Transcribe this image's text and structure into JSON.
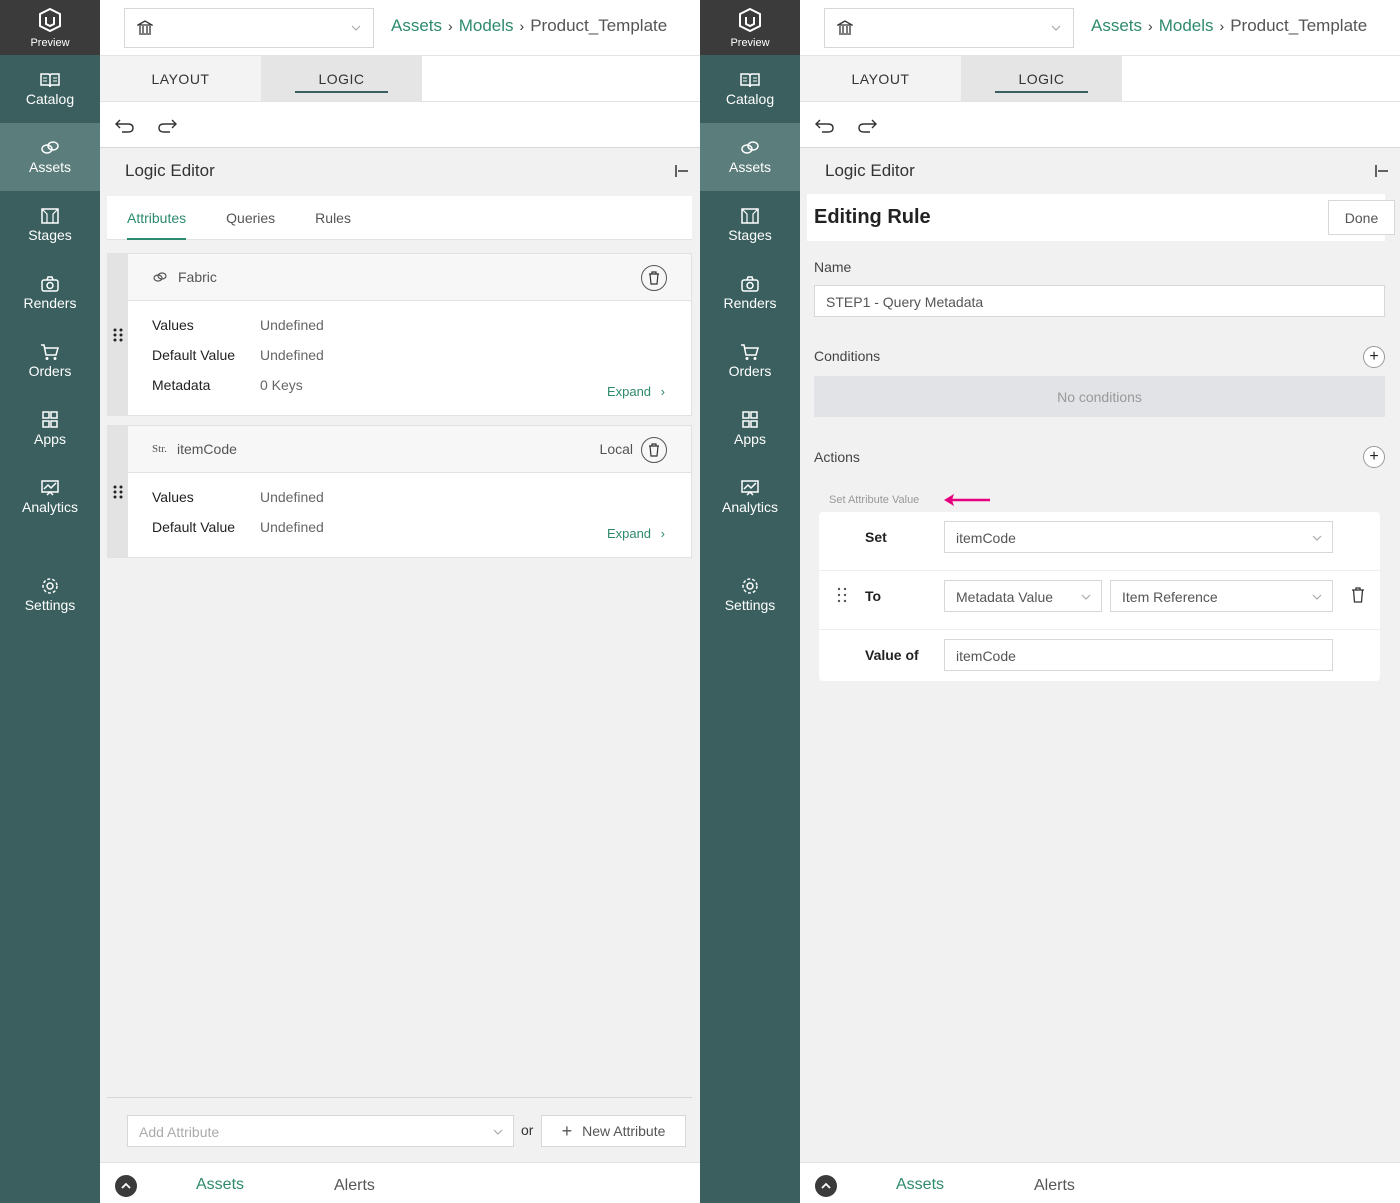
{
  "sidebar": {
    "preview_label": "Preview",
    "items": [
      {
        "label": "Catalog",
        "icon": "book-icon"
      },
      {
        "label": "Assets",
        "icon": "assets-icon"
      },
      {
        "label": "Stages",
        "icon": "stage-icon"
      },
      {
        "label": "Renders",
        "icon": "camera-icon"
      },
      {
        "label": "Orders",
        "icon": "cart-icon"
      },
      {
        "label": "Apps",
        "icon": "grid-icon"
      },
      {
        "label": "Analytics",
        "icon": "chart-icon"
      }
    ],
    "settings_label": "Settings"
  },
  "breadcrumb": {
    "assets": "Assets",
    "models": "Models",
    "current": "Product_Template"
  },
  "tabs": {
    "layout": "LAYOUT",
    "logic": "LOGIC"
  },
  "logic_editor": {
    "title": "Logic Editor"
  },
  "left": {
    "subtabs": [
      "Attributes",
      "Queries",
      "Rules"
    ],
    "attributes": [
      {
        "name": "Fabric",
        "type_icon": "assets-icon",
        "rows": [
          {
            "k": "Values",
            "v": "Undefined"
          },
          {
            "k": "Default Value",
            "v": "Undefined"
          },
          {
            "k": "Metadata",
            "v": "0 Keys"
          }
        ],
        "expand": "Expand"
      },
      {
        "name": "itemCode",
        "type_label": "Str.",
        "local": "Local",
        "rows": [
          {
            "k": "Values",
            "v": "Undefined"
          },
          {
            "k": "Default Value",
            "v": "Undefined"
          }
        ],
        "expand": "Expand"
      }
    ],
    "add_attribute_placeholder": "Add Attribute",
    "or": "or",
    "new_attribute": "New Attribute"
  },
  "right": {
    "rule_title": "Editing Rule",
    "done": "Done",
    "name_label": "Name",
    "name_value": "STEP1 - Query Metadata",
    "conditions_label": "Conditions",
    "no_conditions": "No conditions",
    "actions_label": "Actions",
    "action_title": "Set Attribute Value",
    "set_label": "Set",
    "set_value": "itemCode",
    "to_label": "To",
    "to_value_1": "Metadata Value",
    "to_value_2": "Item Reference",
    "value_of_label": "Value of",
    "value_of_value": "itemCode"
  },
  "footer": {
    "assets": "Assets",
    "alerts": "Alerts"
  },
  "colors": {
    "sidebar": "#3a5f5e",
    "accent": "#2e8a6e",
    "arrow": "#e6007e"
  }
}
